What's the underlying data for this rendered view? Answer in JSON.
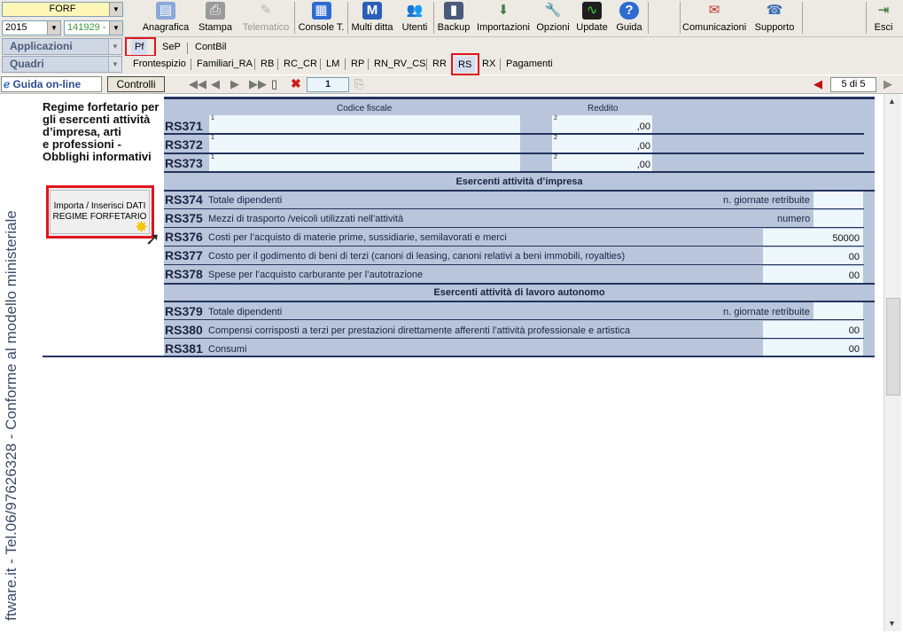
{
  "top_selectors": {
    "model": "FORF",
    "year": "2015",
    "client_code": "141929 -"
  },
  "toolbar": {
    "buttons": [
      {
        "label": "Anagrafica",
        "icon": "id-card-icon"
      },
      {
        "label": "Stampa",
        "icon": "printer-icon"
      },
      {
        "label": "Telematico",
        "icon": "telematico-icon"
      },
      {
        "label": "Console T.",
        "icon": "console-icon"
      },
      {
        "label": "Multi ditta",
        "icon": "multi-ditta-icon"
      },
      {
        "label": "Utenti",
        "icon": "users-icon"
      },
      {
        "label": "Backup",
        "icon": "backup-icon"
      },
      {
        "label": "Importazioni",
        "icon": "import-icon"
      },
      {
        "label": "Opzioni",
        "icon": "wrench-icon"
      },
      {
        "label": "Update",
        "icon": "update-icon"
      },
      {
        "label": "Guida",
        "icon": "help-icon"
      },
      {
        "label": "Comunicazioni",
        "icon": "communications-icon"
      },
      {
        "label": "Supporto",
        "icon": "support-icon"
      },
      {
        "label": "Esci",
        "icon": "exit-icon"
      }
    ]
  },
  "nav": {
    "applicazioni_label": "Applicazioni",
    "quadri_label": "Quadri",
    "app_tabs": [
      "Pf",
      "SeP",
      "ContBil"
    ],
    "quadri_tabs": [
      "Frontespizio",
      "Familiari_RA",
      "RB",
      "RC_CR",
      "LM",
      "RP",
      "RN_RV_CS",
      "RR",
      "RS",
      "RX",
      "Pagamenti"
    ],
    "active_quadro": "RS"
  },
  "bar3": {
    "guida_label": "Guida on-line",
    "controlli_label": "Controlli",
    "page_input": "1",
    "page_indicator": "5 di 5"
  },
  "sidebar": {
    "vertical_text": "ftware.it - Tel.06/97626328 - Conforme al modello ministeriale"
  },
  "form": {
    "section_title_lines": [
      "Regime forfetario per",
      "gli esercenti attività",
      "d’impresa, arti",
      "e professioni -",
      "Obblighi informativi"
    ],
    "import_button_lines": [
      "Importa / Inserisci DATI",
      "REGIME FORFETARIO"
    ],
    "col_codice_fiscale": "Codice fiscale",
    "col_reddito": "Reddito",
    "top_rows": [
      {
        "code": "RS371",
        "sup_cf": "1",
        "sup_r": "2",
        "value": ",00"
      },
      {
        "code": "RS372",
        "sup_cf": "1",
        "sup_r": "2",
        "value": ",00"
      },
      {
        "code": "RS373",
        "sup_cf": "1",
        "sup_r": "2",
        "value": ",00"
      }
    ],
    "section_impresa": "Esercenti attività d’impresa",
    "impresa_rows": [
      {
        "code": "RS374",
        "desc": "Totale dipendenti",
        "right_label": "n. giornate retribuite",
        "value": ""
      },
      {
        "code": "RS375",
        "desc": "Mezzi di trasporto /veicoli utilizzati nell’attività",
        "right_label": "numero",
        "value": ""
      },
      {
        "code": "RS376",
        "desc": "Costi per l’acquisto di materie prime, sussidiarie, semilavorati e merci",
        "right_label": "",
        "value": "50000"
      },
      {
        "code": "RS377",
        "desc": "Costo per il godimento di beni di terzi (canoni di leasing, canoni relativi a beni immobili, royalties)",
        "right_label": "",
        "value": "00"
      },
      {
        "code": "RS378",
        "desc": "Spese per l’acquisto carburante per l’autotrazione",
        "right_label": "",
        "value": "00"
      }
    ],
    "section_autonomo": "Esercenti attività di lavoro autonomo",
    "autonomo_rows": [
      {
        "code": "RS379",
        "desc": "Totale dipendenti",
        "right_label": "n. giornate retribuite",
        "value": ""
      },
      {
        "code": "RS380",
        "desc": "Compensi corrisposti a terzi per prestazioni direttamente afferenti l’attività professionale e artistica",
        "right_label": "",
        "value": "00"
      },
      {
        "code": "RS381",
        "desc": "Consumi",
        "right_label": "",
        "value": "00"
      }
    ]
  },
  "colors": {
    "form_bg": "#b9c5da",
    "field_bg": "#eef7fb",
    "line": "#22345e",
    "highlight": "#e0141e"
  }
}
